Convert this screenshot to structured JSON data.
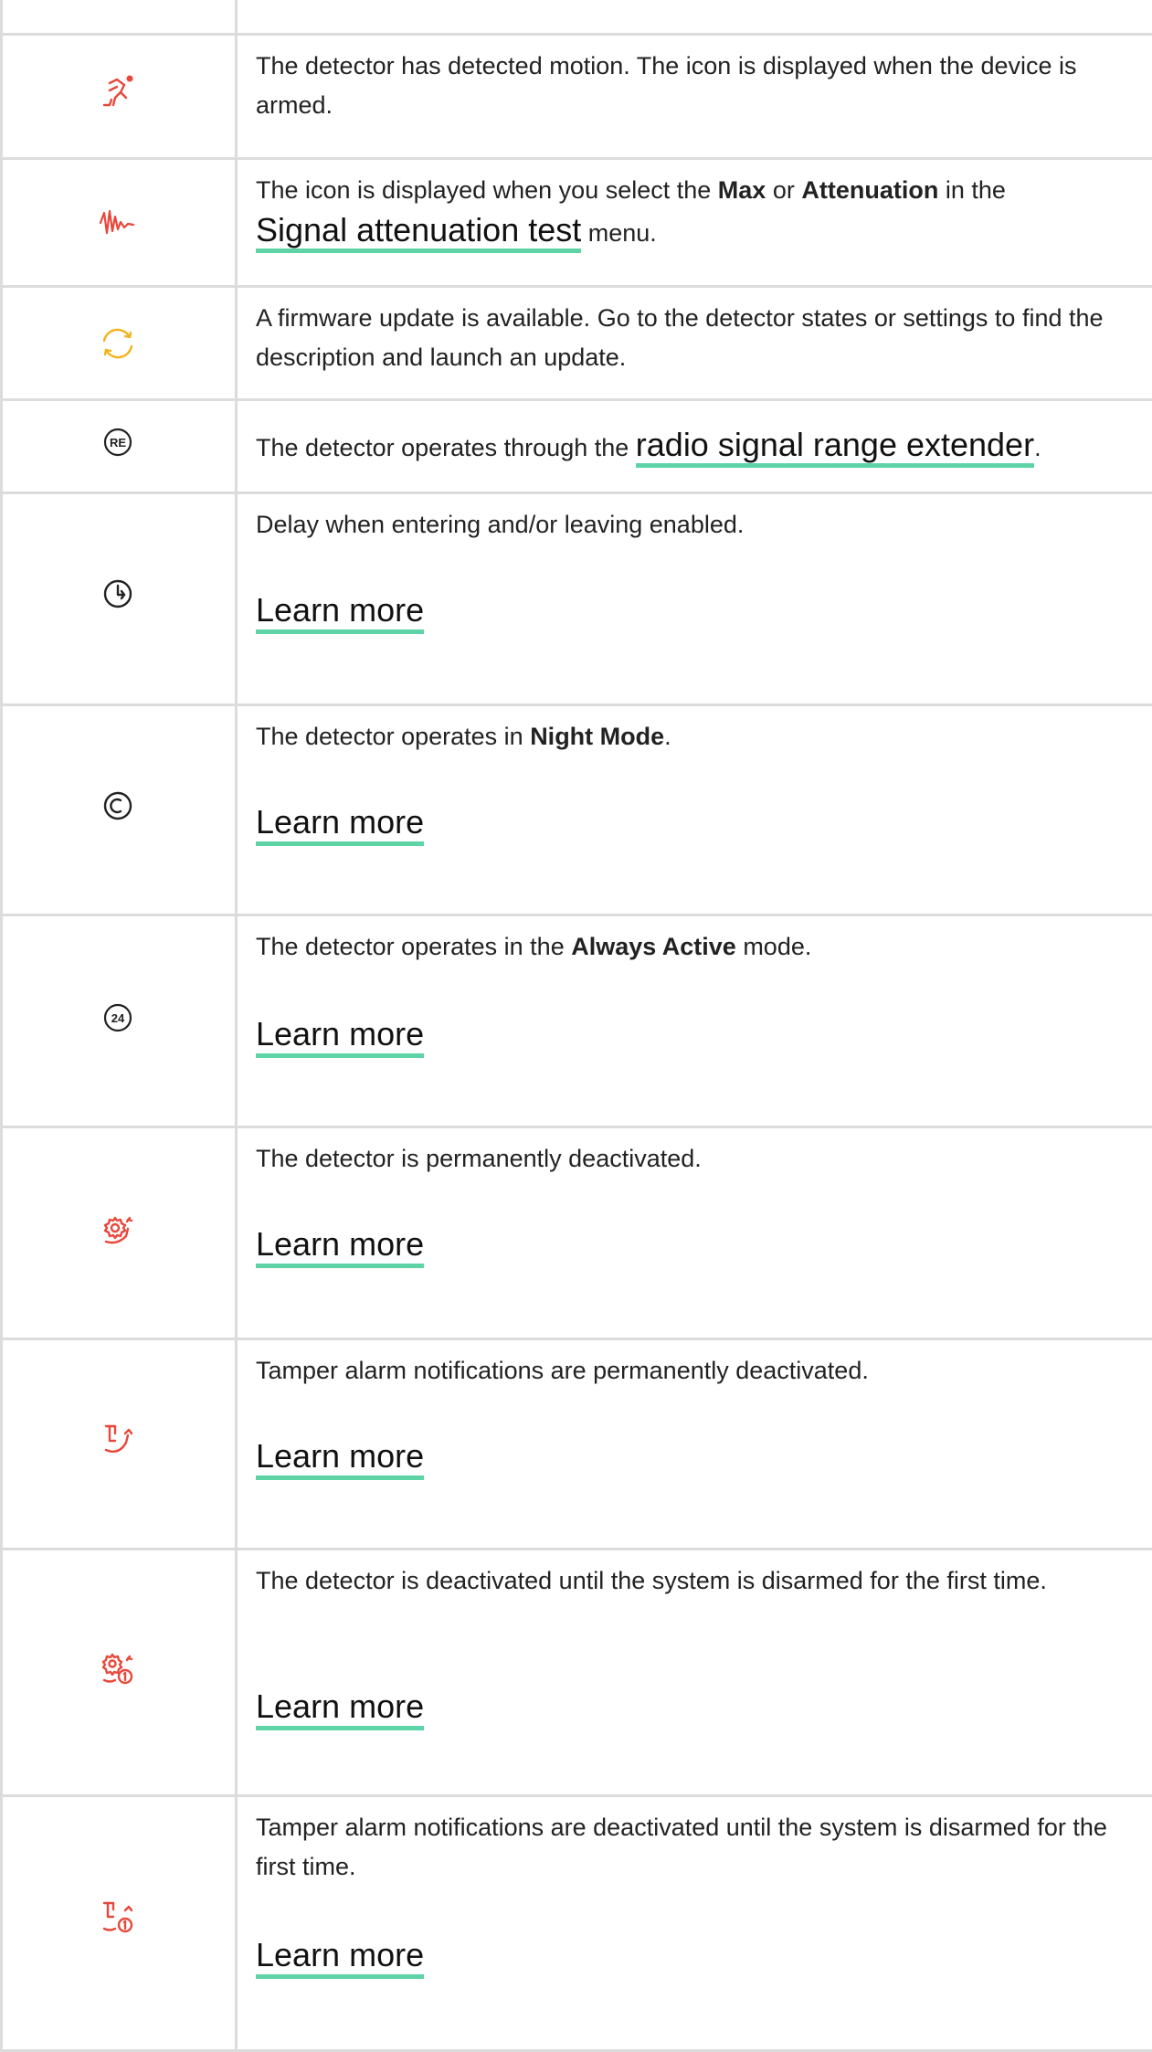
{
  "colors": {
    "accent_underline": "#5ed4a6",
    "icon_red": "#e8473a",
    "icon_yellow": "#f2b21b",
    "icon_dark": "#222222",
    "border": "#dcdcdc"
  },
  "rows": [
    {
      "icon": "motion-running-icon",
      "text": "The detector has detected motion. The icon is displayed when the device is armed."
    },
    {
      "icon": "signal-wave-icon",
      "text_before": "The icon is displayed when you select the ",
      "bold_1": "Max",
      "text_mid": " or ",
      "bold_2": "Attenuation",
      "text_after": " in the",
      "link": "Signal attenuation test",
      "text_end": " menu."
    },
    {
      "icon": "firmware-update-icon",
      "text": "A firmware update is available. Go to the detector states or settings to find the description and launch an update."
    },
    {
      "icon": "range-extender-re-icon",
      "icon_text": "RE",
      "text_before": "The detector operates through the ",
      "link": "radio signal range extender",
      "text_end": "."
    },
    {
      "icon": "delay-clock-icon",
      "text": "Delay when entering and/or leaving enabled.",
      "learn": "Learn more"
    },
    {
      "icon": "night-mode-icon",
      "text_before": "The detector operates in ",
      "bold": "Night Mode",
      "text_end": ".",
      "learn": "Learn more"
    },
    {
      "icon": "always-active-24-icon",
      "icon_text": "24",
      "text_before": "The detector operates in the ",
      "bold": "Always Active",
      "text_end": " mode.",
      "learn": "Learn more"
    },
    {
      "icon": "gear-deactivated-icon",
      "text": "The detector is permanently deactivated.",
      "learn": "Learn more"
    },
    {
      "icon": "tamper-deactivated-icon",
      "text": "Tamper alarm notifications are permanently deactivated.",
      "learn": "Learn more"
    },
    {
      "icon": "gear-deactivated-until-disarm-icon",
      "text": "The detector is deactivated until the system is disarmed for the first time.",
      "learn": "Learn more"
    },
    {
      "icon": "tamper-deactivated-until-disarm-icon",
      "text": "Tamper alarm notifications are deactivated until the system is disarmed for the first time.",
      "learn": "Learn more"
    }
  ]
}
